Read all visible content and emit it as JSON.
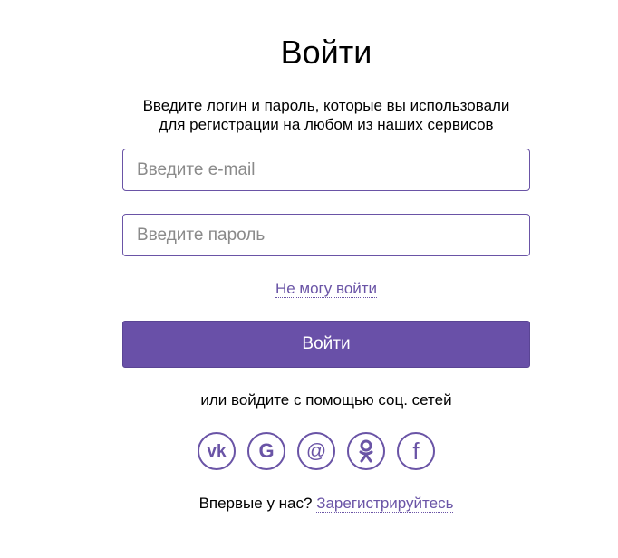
{
  "login": {
    "title": "Войти",
    "subtitle_line1": "Введите логин и пароль, которые вы использовали",
    "subtitle_line2": "для регистрации на любом из наших сервисов",
    "email_placeholder": "Введите e-mail",
    "password_placeholder": "Введите пароль",
    "cant_login": "Не могу войти",
    "submit_label": "Войти",
    "social_caption": "или войдите с помощью соц. сетей",
    "social": [
      {
        "name": "vk",
        "icon": "vk-icon",
        "label": "vk"
      },
      {
        "name": "google",
        "icon": "google-icon",
        "label": "G"
      },
      {
        "name": "mail",
        "icon": "at-icon",
        "label": "@"
      },
      {
        "name": "odnoklassniki",
        "icon": "odnoklassniki-icon"
      },
      {
        "name": "facebook",
        "icon": "facebook-icon",
        "label": "f"
      }
    ],
    "register_prompt": "Впервые у нас?",
    "register_link": "Зарегистрируйтесь"
  },
  "colors": {
    "accent": "#6a54a6",
    "button_bg": "#6950a8",
    "button_text": "#ffffff",
    "placeholder": "#8a8a8a"
  }
}
